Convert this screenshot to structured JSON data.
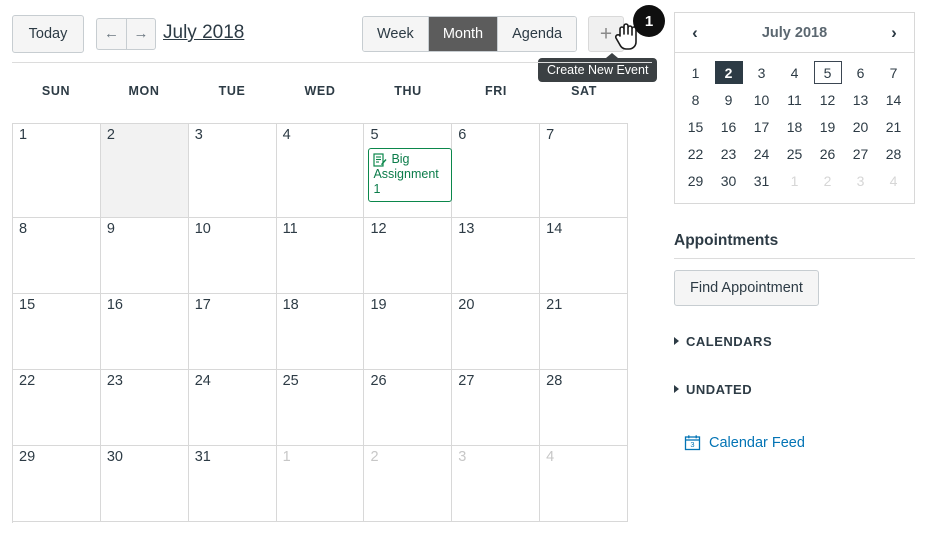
{
  "toolbar": {
    "today_label": "Today",
    "prev_icon": "←",
    "next_icon": "→",
    "month_title": "July 2018",
    "views": [
      {
        "label": "Week",
        "active": false
      },
      {
        "label": "Month",
        "active": true
      },
      {
        "label": "Agenda",
        "active": false
      }
    ],
    "add_event_icon": "+",
    "add_event_tooltip": "Create New Event",
    "badge": "1"
  },
  "calendar": {
    "weekdays": [
      "SUN",
      "MON",
      "TUE",
      "WED",
      "THU",
      "FRI",
      "SAT"
    ],
    "weeks": [
      [
        {
          "num": "1",
          "other": false,
          "today": false
        },
        {
          "num": "2",
          "other": false,
          "today": true
        },
        {
          "num": "3",
          "other": false,
          "today": false
        },
        {
          "num": "4",
          "other": false,
          "today": false
        },
        {
          "num": "5",
          "other": false,
          "today": false,
          "event": {
            "title": "Big Assignment 1",
            "icon": "assignment-icon",
            "color": "#0b874b"
          }
        },
        {
          "num": "6",
          "other": false,
          "today": false
        },
        {
          "num": "7",
          "other": false,
          "today": false
        }
      ],
      [
        {
          "num": "8",
          "other": false,
          "today": false
        },
        {
          "num": "9",
          "other": false,
          "today": false
        },
        {
          "num": "10",
          "other": false,
          "today": false
        },
        {
          "num": "11",
          "other": false,
          "today": false
        },
        {
          "num": "12",
          "other": false,
          "today": false
        },
        {
          "num": "13",
          "other": false,
          "today": false
        },
        {
          "num": "14",
          "other": false,
          "today": false
        }
      ],
      [
        {
          "num": "15",
          "other": false,
          "today": false
        },
        {
          "num": "16",
          "other": false,
          "today": false
        },
        {
          "num": "17",
          "other": false,
          "today": false
        },
        {
          "num": "18",
          "other": false,
          "today": false
        },
        {
          "num": "19",
          "other": false,
          "today": false
        },
        {
          "num": "20",
          "other": false,
          "today": false
        },
        {
          "num": "21",
          "other": false,
          "today": false
        }
      ],
      [
        {
          "num": "22",
          "other": false,
          "today": false
        },
        {
          "num": "23",
          "other": false,
          "today": false
        },
        {
          "num": "24",
          "other": false,
          "today": false
        },
        {
          "num": "25",
          "other": false,
          "today": false
        },
        {
          "num": "26",
          "other": false,
          "today": false
        },
        {
          "num": "27",
          "other": false,
          "today": false
        },
        {
          "num": "28",
          "other": false,
          "today": false
        }
      ],
      [
        {
          "num": "29",
          "other": false,
          "today": false
        },
        {
          "num": "30",
          "other": false,
          "today": false
        },
        {
          "num": "31",
          "other": false,
          "today": false
        },
        {
          "num": "1",
          "other": true,
          "today": false
        },
        {
          "num": "2",
          "other": true,
          "today": false
        },
        {
          "num": "3",
          "other": true,
          "today": false
        },
        {
          "num": "4",
          "other": true,
          "today": false
        }
      ]
    ]
  },
  "mini_calendar": {
    "prev_icon": "‹",
    "next_icon": "›",
    "title": "July 2018",
    "weeks": [
      [
        {
          "num": "1",
          "state": "normal"
        },
        {
          "num": "2",
          "state": "selected"
        },
        {
          "num": "3",
          "state": "normal"
        },
        {
          "num": "4",
          "state": "normal"
        },
        {
          "num": "5",
          "state": "outlined"
        },
        {
          "num": "6",
          "state": "normal"
        },
        {
          "num": "7",
          "state": "normal"
        }
      ],
      [
        {
          "num": "8",
          "state": "normal"
        },
        {
          "num": "9",
          "state": "normal"
        },
        {
          "num": "10",
          "state": "normal"
        },
        {
          "num": "11",
          "state": "normal"
        },
        {
          "num": "12",
          "state": "normal"
        },
        {
          "num": "13",
          "state": "normal"
        },
        {
          "num": "14",
          "state": "normal"
        }
      ],
      [
        {
          "num": "15",
          "state": "normal"
        },
        {
          "num": "16",
          "state": "normal"
        },
        {
          "num": "17",
          "state": "normal"
        },
        {
          "num": "18",
          "state": "normal"
        },
        {
          "num": "19",
          "state": "normal"
        },
        {
          "num": "20",
          "state": "normal"
        },
        {
          "num": "21",
          "state": "normal"
        }
      ],
      [
        {
          "num": "22",
          "state": "normal"
        },
        {
          "num": "23",
          "state": "normal"
        },
        {
          "num": "24",
          "state": "normal"
        },
        {
          "num": "25",
          "state": "normal"
        },
        {
          "num": "26",
          "state": "normal"
        },
        {
          "num": "27",
          "state": "normal"
        },
        {
          "num": "28",
          "state": "normal"
        }
      ],
      [
        {
          "num": "29",
          "state": "normal"
        },
        {
          "num": "30",
          "state": "normal"
        },
        {
          "num": "31",
          "state": "normal"
        },
        {
          "num": "1",
          "state": "other"
        },
        {
          "num": "2",
          "state": "other"
        },
        {
          "num": "3",
          "state": "other"
        },
        {
          "num": "4",
          "state": "other"
        }
      ]
    ]
  },
  "sidebar": {
    "appointments_title": "Appointments",
    "find_appointment_label": "Find Appointment",
    "calendars_label": "CALENDARS",
    "undated_label": "UNDATED",
    "calendar_feed_label": "Calendar Feed",
    "calendar_feed_icon": "calendar-icon"
  },
  "colors": {
    "accent_link": "#0374b5",
    "event_green": "#0b874b",
    "selected_dark": "#2d3b45",
    "active_view": "#5c5c5c"
  }
}
